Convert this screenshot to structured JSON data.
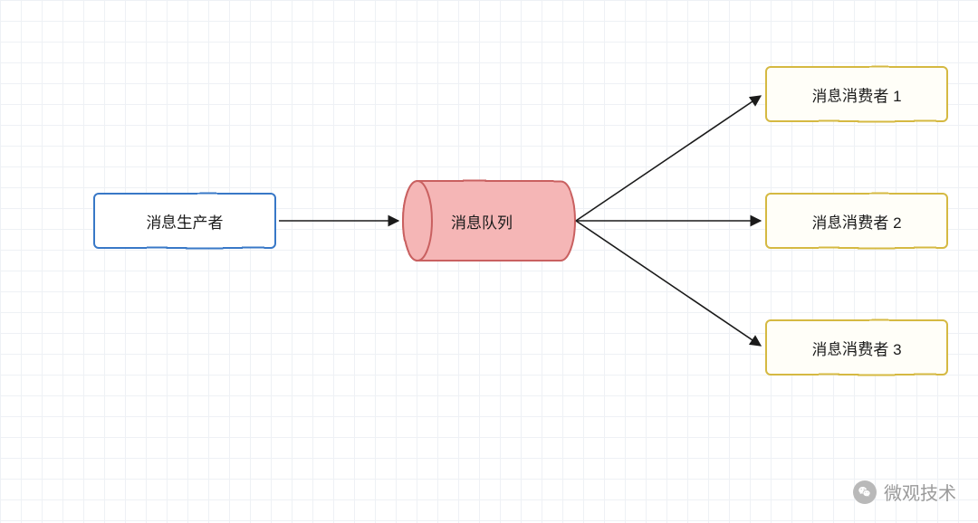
{
  "nodes": {
    "producer": "消息生产者",
    "queue": "消息队列",
    "consumer1": "消息消费者 1",
    "consumer2": "消息消费者 2",
    "consumer3": "消息消费者 3"
  },
  "watermark": "微观技术",
  "diagram": {
    "type": "message-queue-fanout",
    "edges": [
      [
        "producer",
        "queue"
      ],
      [
        "queue",
        "consumer1"
      ],
      [
        "queue",
        "consumer2"
      ],
      [
        "queue",
        "consumer3"
      ]
    ]
  }
}
